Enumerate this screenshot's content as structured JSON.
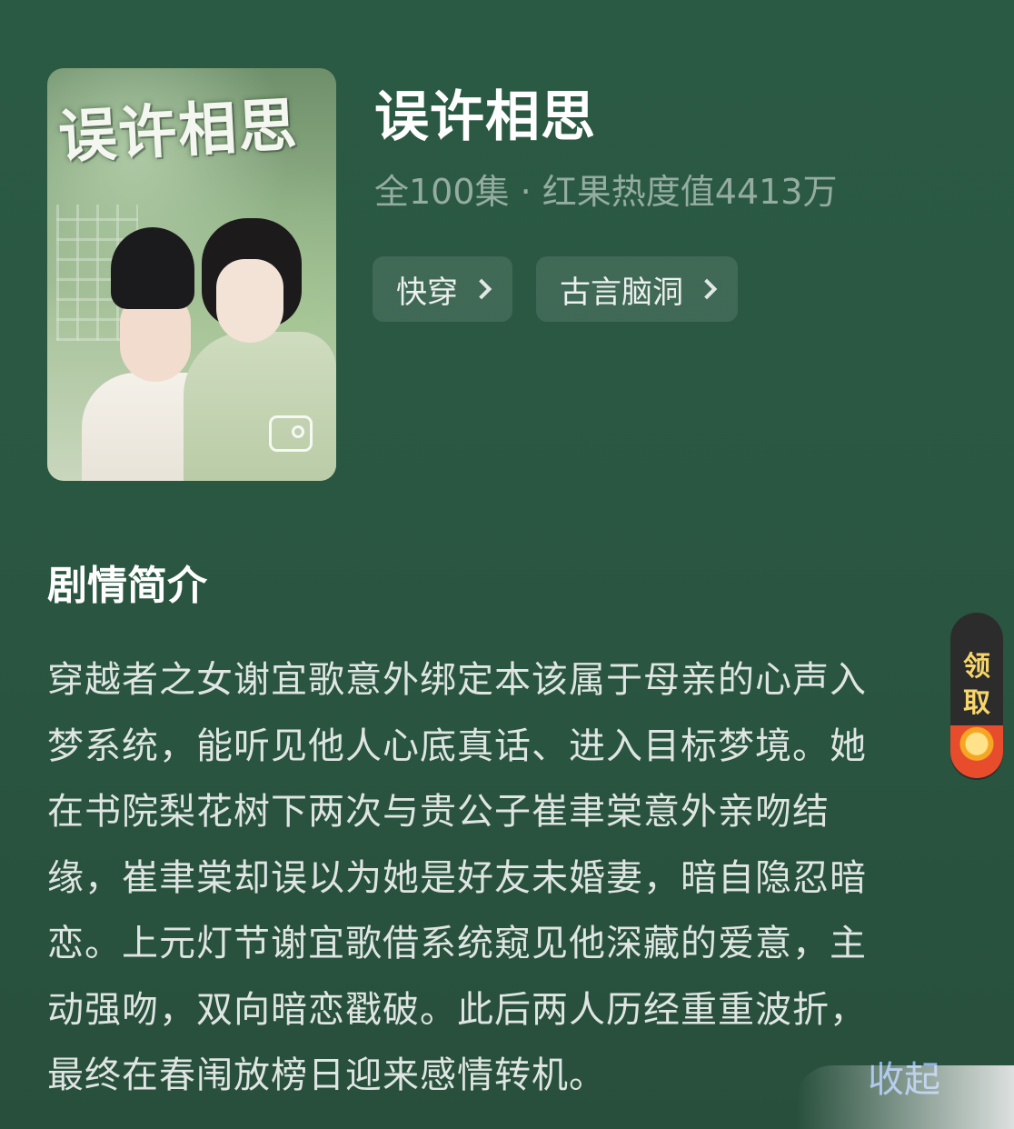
{
  "drama": {
    "title": "误许相思",
    "meta": "全100集 · 红果热度值4413万",
    "cover_title": "误许相思",
    "tags": [
      {
        "label": "快穿"
      },
      {
        "label": "古言脑洞"
      }
    ]
  },
  "synopsis": {
    "heading": "剧情简介",
    "lines": [
      "穿越者之女谢宜歌意外绑定本该属于母亲的心声入",
      "梦系统，能听见他人心底真话、进入目标梦境。她",
      "在书院梨花树下两次与贵公子崔聿棠意外亲吻结",
      "缘，崔聿棠却误以为她是好友未婚妻，暗自隐忍暗",
      "恋。上元灯节谢宜歌借系统窥见他深藏的爱意，主",
      "动强吻，双向暗恋戳破。此后两人历经重重波折，",
      "最终在春闱放榜日迎来感情转机。"
    ],
    "collapse_label": "收起"
  },
  "reward": {
    "label": "领取",
    "icon": "red-envelope-coin-icon"
  }
}
